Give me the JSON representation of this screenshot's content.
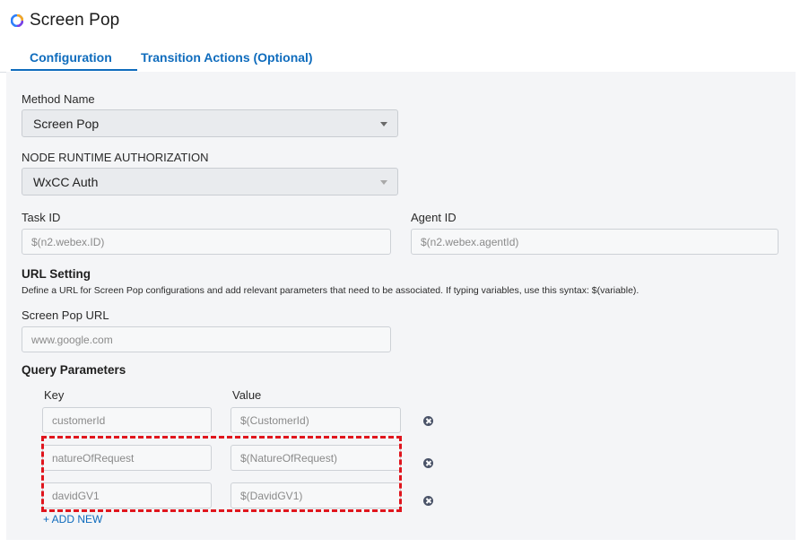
{
  "header": {
    "title": "Screen Pop",
    "logo_icon": "webex-logo-icon"
  },
  "tabs": [
    {
      "label": "Configuration",
      "active": true
    },
    {
      "label": "Transition Actions (Optional)",
      "active": false
    }
  ],
  "method_name": {
    "label": "Method Name",
    "value": "Screen Pop"
  },
  "node_runtime_auth": {
    "label": "NODE RUNTIME AUTHORIZATION",
    "value": "WxCC Auth"
  },
  "task_id": {
    "label": "Task ID",
    "value": "$(n2.webex.ID)"
  },
  "agent_id": {
    "label": "Agent ID",
    "value": "$(n2.webex.agentId)"
  },
  "url_setting": {
    "title": "URL Setting",
    "description": "Define a URL for Screen Pop configurations and add relevant parameters that need to be associated. If typing variables, use this syntax: $(variable).",
    "url_label": "Screen Pop URL",
    "url_value": "www.google.com"
  },
  "query_parameters": {
    "title": "Query Parameters",
    "key_header": "Key",
    "value_header": "Value",
    "rows": [
      {
        "key": "customerId",
        "value": "$(CustomerId)"
      },
      {
        "key": "natureOfRequest",
        "value": "$(NatureOfRequest)"
      },
      {
        "key": "davidGV1",
        "value": "$(DavidGV1)"
      }
    ],
    "add_label": "+ ADD NEW"
  },
  "colors": {
    "accent": "#0f6cbd",
    "highlight": "#e0151d",
    "panel_bg": "#f4f5f7"
  }
}
